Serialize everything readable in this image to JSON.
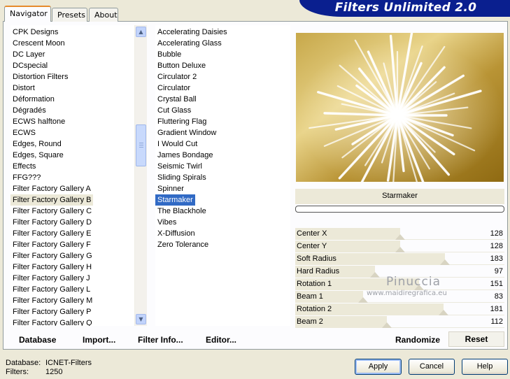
{
  "window": {
    "title": "Filters Unlimited 2.0"
  },
  "tabs": [
    {
      "label": "Navigator",
      "active": true
    },
    {
      "label": "Presets",
      "active": false
    },
    {
      "label": "About",
      "active": false
    }
  ],
  "categories": {
    "items": [
      "CPK Designs",
      "Crescent Moon",
      "DC Layer",
      "DCspecial",
      "Distortion Filters",
      "Distort",
      "Déformation",
      "Dégradés",
      "ECWS halftone",
      "ECWS",
      "Edges, Round",
      "Edges, Square",
      "Effects",
      "FFG???",
      "Filter Factory Gallery A",
      "Filter Factory Gallery B",
      "Filter Factory Gallery C",
      "Filter Factory Gallery D",
      "Filter Factory Gallery E",
      "Filter Factory Gallery F",
      "Filter Factory Gallery G",
      "Filter Factory Gallery H",
      "Filter Factory Gallery J",
      "Filter Factory Gallery L",
      "Filter Factory Gallery M",
      "Filter Factory Gallery P",
      "Filter Factory Gallery Q"
    ],
    "selected": "Filter Factory Gallery B"
  },
  "filters": {
    "items": [
      "Accelerating Daisies",
      "Accelerating Glass",
      "Bubble",
      "Button Deluxe",
      "Circulator 2",
      "Circulator",
      "Crystal Ball",
      "Cut Glass",
      "Fluttering Flag",
      "Gradient Window",
      "I Would Cut",
      "James Bondage",
      "Seismic Twirl",
      "Sliding Spirals",
      "Spinner",
      "Starmaker",
      "The Blackhole",
      "Vibes",
      "X-Diffusion",
      "Zero Tolerance"
    ],
    "selected": "Starmaker"
  },
  "preview": {
    "filter_name": "Starmaker"
  },
  "parameters": [
    {
      "label": "Center X",
      "value": "128",
      "level": 0.5
    },
    {
      "label": "Center Y",
      "value": "128",
      "level": 0.5
    },
    {
      "label": "Soft Radius",
      "value": "183",
      "level": 0.717
    },
    {
      "label": "Hard Radius",
      "value": "97",
      "level": 0.38
    },
    {
      "label": "Rotation 1",
      "value": "151",
      "level": 0.592
    },
    {
      "label": "Beam 1",
      "value": "83",
      "level": 0.325
    },
    {
      "label": "Rotation 2",
      "value": "181",
      "level": 0.71
    },
    {
      "label": "Beam 2",
      "value": "112",
      "level": 0.439
    }
  ],
  "watermark": {
    "name": "Pinuccia",
    "site": "www.maidiregrafica.eu"
  },
  "toolbar": {
    "database": "Database",
    "import": "Import...",
    "filter_info": "Filter Info...",
    "editor": "Editor...",
    "randomize": "Randomize",
    "reset": "Reset"
  },
  "status": {
    "database_label": "Database:",
    "database_value": "ICNET-Filters",
    "filters_label": "Filters:",
    "filters_value": "1250"
  },
  "dialog_buttons": {
    "apply": "Apply",
    "cancel": "Cancel",
    "help": "Help"
  },
  "colors": {
    "banner": "#0a1f8f",
    "selection": "#316ac5",
    "preview_gold": "#b08a26"
  },
  "icons": {
    "scroll_up": "arrow-up-icon",
    "scroll_down": "arrow-down-icon"
  }
}
